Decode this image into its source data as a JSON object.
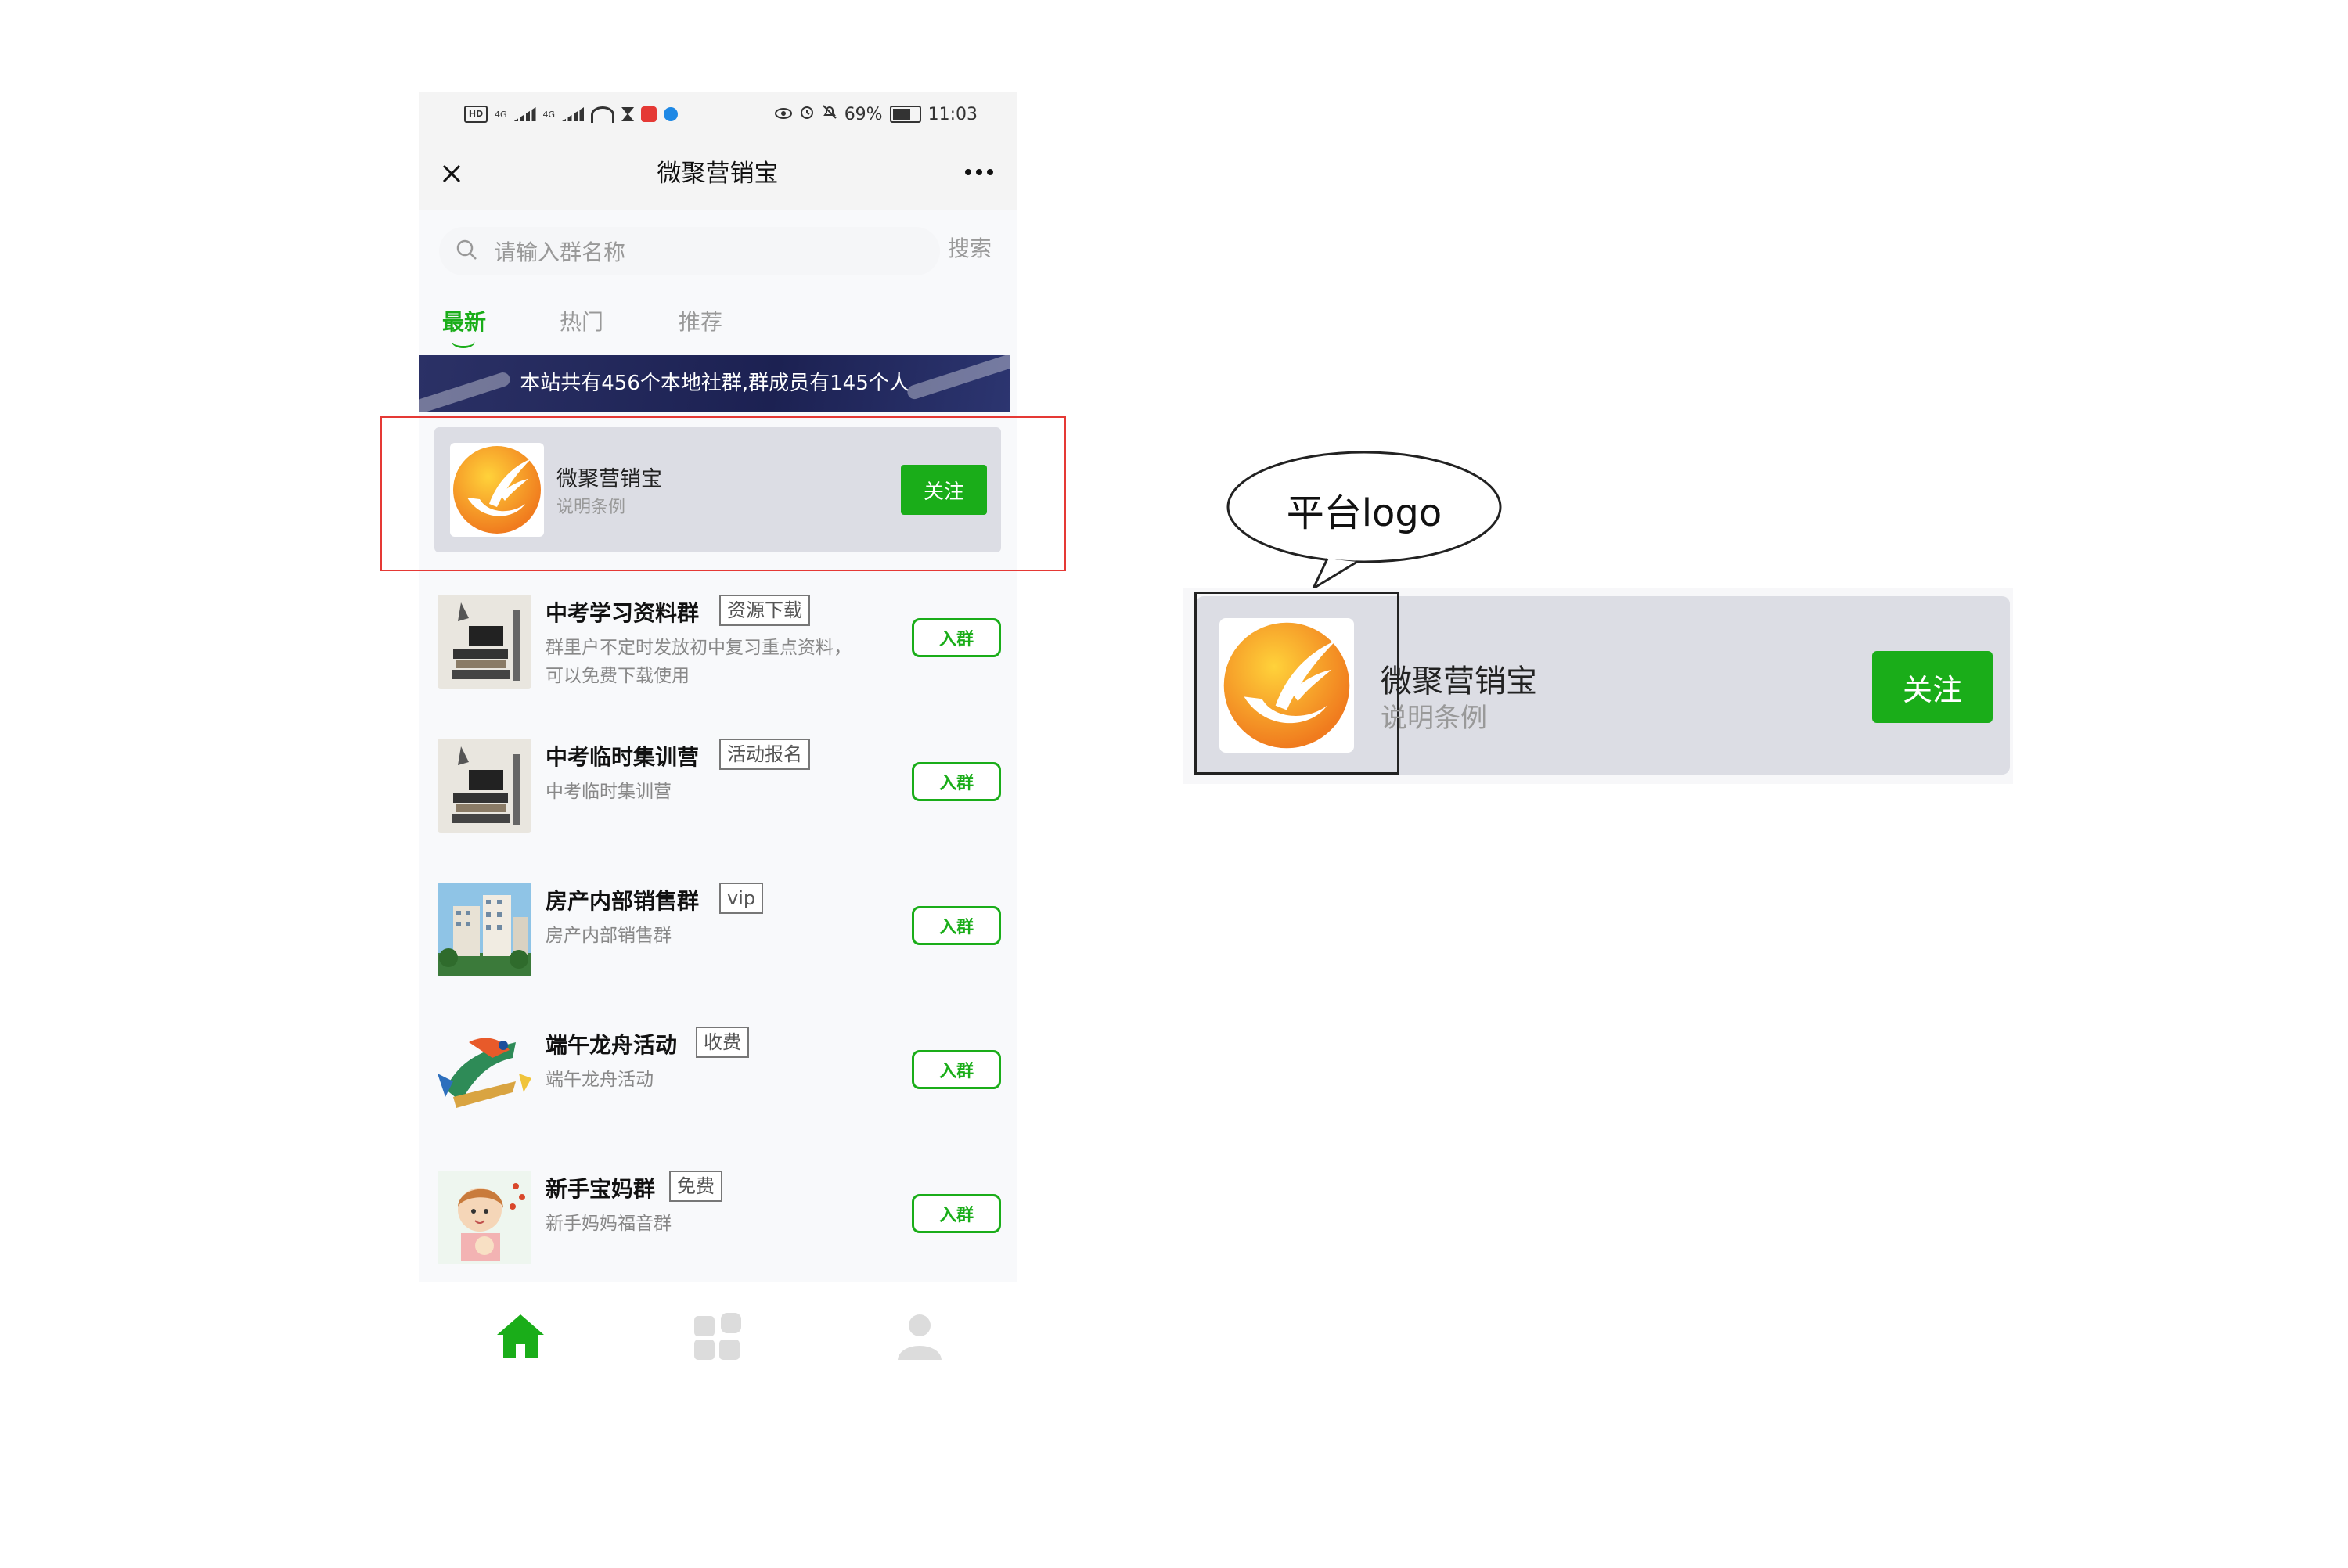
{
  "status_bar": {
    "hd_label": "HD",
    "network_left": "4G",
    "network_right": "4G",
    "battery": "69%",
    "time": "11:03",
    "icons": [
      "hd-icon",
      "signal-icon",
      "signal-icon",
      "wifi-icon",
      "hourglass-icon",
      "app-icon",
      "app-icon",
      "eye-icon",
      "alarm-icon",
      "mute-icon",
      "battery-icon"
    ]
  },
  "nav": {
    "title": "微聚营销宝",
    "more_label": "···",
    "icons": {
      "close": "close-icon",
      "more": "more-icon"
    }
  },
  "search": {
    "placeholder": "请输入群名称",
    "value": "",
    "button_label": "搜索",
    "icon": "search-icon"
  },
  "tabs": [
    {
      "label": "最新",
      "active": true
    },
    {
      "label": "热门",
      "active": false
    },
    {
      "label": "推荐",
      "active": false
    }
  ],
  "banner": {
    "text": "本站共有456个本地社群,群成员有145个人"
  },
  "featured": {
    "name": "微聚营销宝",
    "desc": "说明条例",
    "follow_label": "关注",
    "logo_colors": {
      "outer": "#f5a612",
      "inner": "#f07b1e",
      "accent": "#ffffff"
    }
  },
  "groups": [
    {
      "title": "中考学习资料群",
      "tag": "资源下载",
      "desc": "群里户不定时发放初中复习重点资料，可以免费下载使用",
      "join_label": "入群",
      "thumb": "books-icon"
    },
    {
      "title": "中考临时集训营",
      "tag": "活动报名",
      "desc": "中考临时集训营",
      "join_label": "入群",
      "thumb": "books-icon"
    },
    {
      "title": "房产内部销售群",
      "tag": "vip",
      "desc": "房产内部销售群",
      "join_label": "入群",
      "thumb": "building-icon"
    },
    {
      "title": "端午龙舟活动",
      "tag": "收费",
      "desc": "端午龙舟活动",
      "join_label": "入群",
      "thumb": "dragon-icon"
    },
    {
      "title": "新手宝妈群",
      "tag": "免费",
      "desc": "新手妈妈福音群",
      "join_label": "入群",
      "thumb": "mother-icon"
    }
  ],
  "bottom_nav": [
    {
      "icon": "home-icon",
      "active": true
    },
    {
      "icon": "apps-icon",
      "active": false
    },
    {
      "icon": "user-icon",
      "active": false
    }
  ],
  "annotation": {
    "callout_text": "平台logo",
    "zoom": {
      "name": "微聚营销宝",
      "desc": "说明条例",
      "follow_label": "关注"
    }
  },
  "colors": {
    "accent": "#1aad19",
    "banner_bg": "#1c2152",
    "highlight_box": "#e53935",
    "card_bg": "#dcdde4"
  }
}
